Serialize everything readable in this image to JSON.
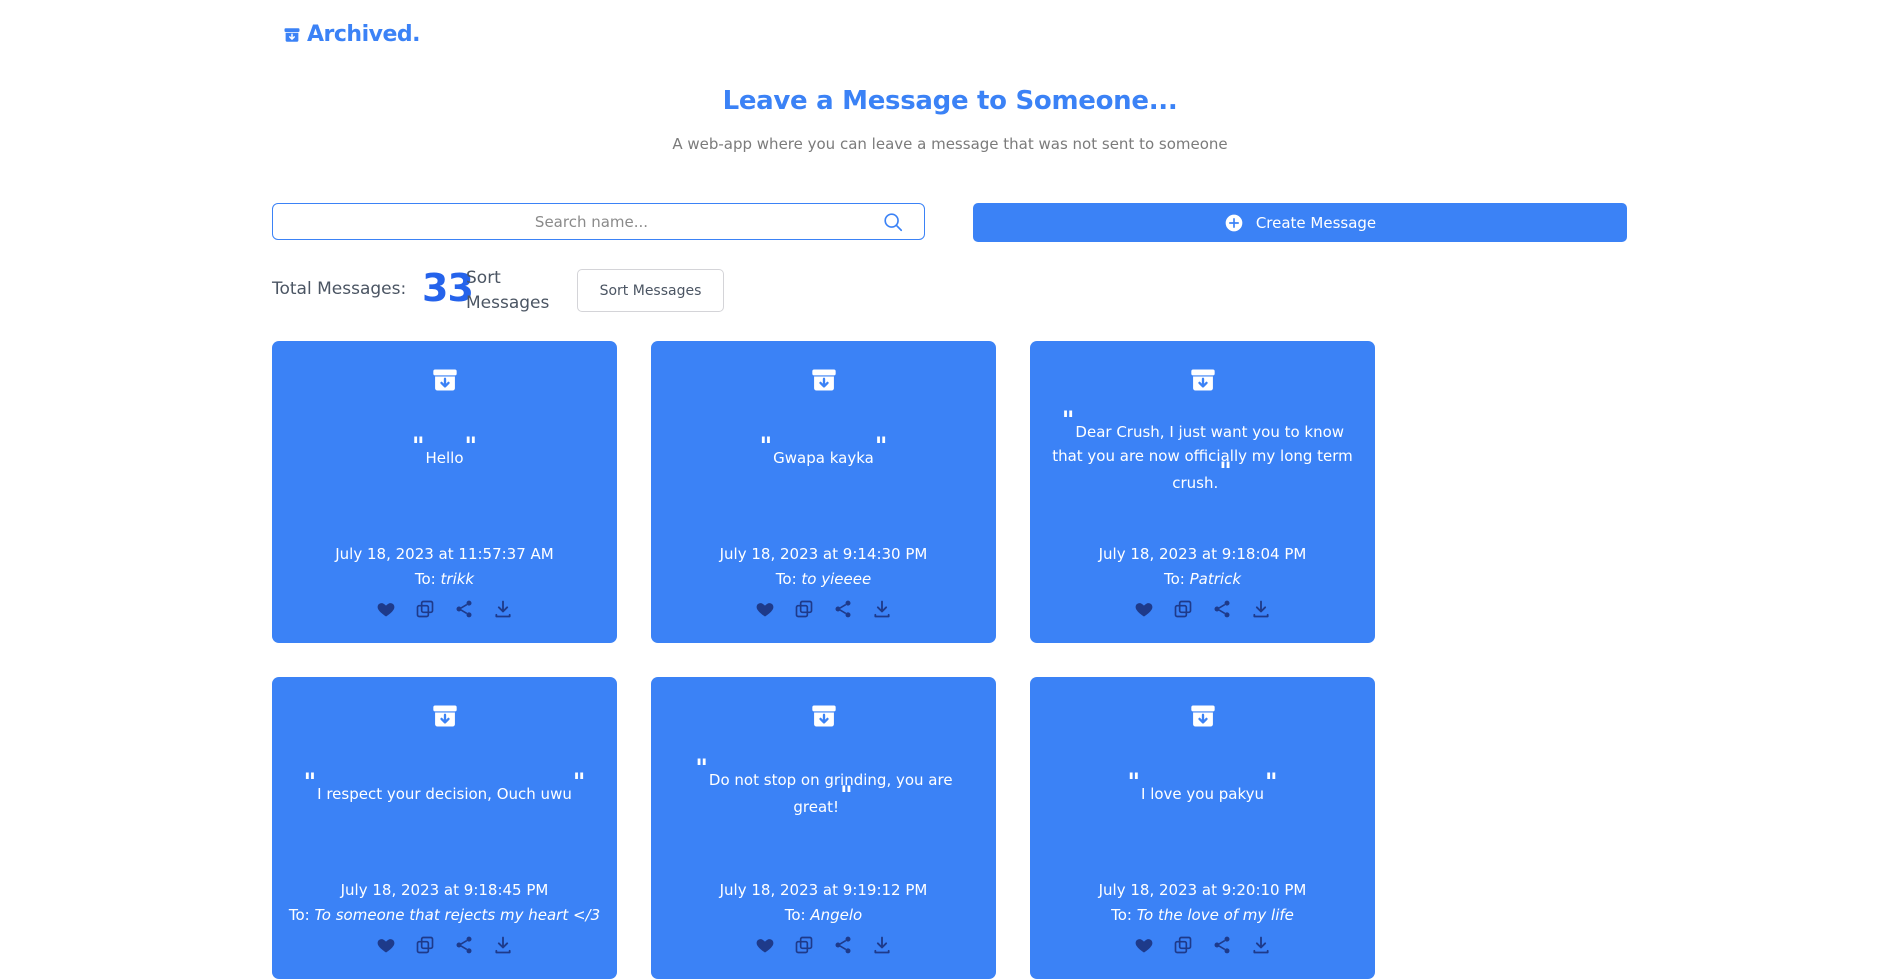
{
  "logo": {
    "text": "Archived."
  },
  "header": {
    "title": "Leave a Message to Someone...",
    "subtitle": "A web-app where you can leave a message that was not sent to someone"
  },
  "search": {
    "placeholder": "Search name..."
  },
  "create_button": {
    "label": "Create Message"
  },
  "stats": {
    "total_label": "Total Messages:",
    "total_count": "33",
    "sort_label": "Sort Messages",
    "sort_button": "Sort Messages"
  },
  "cards": [
    {
      "message": "Hello",
      "date": "July 18, 2023 at 11:57:37 AM",
      "to_prefix": "To:",
      "recipient": "trikk"
    },
    {
      "message": "Gwapa kayka",
      "date": "July 18, 2023 at 9:14:30 PM",
      "to_prefix": "To:",
      "recipient": "to yieeee"
    },
    {
      "message": "Dear Crush, I just want you to know that you are now officially my long term crush.",
      "date": "July 18, 2023 at 9:18:04 PM",
      "to_prefix": "To:",
      "recipient": "Patrick"
    },
    {
      "message": "I respect your decision, Ouch uwu",
      "date": "July 18, 2023 at 9:18:45 PM",
      "to_prefix": "To:",
      "recipient": "To someone that rejects my heart </3"
    },
    {
      "message": "Do not stop on grinding, you are great!",
      "date": "July 18, 2023 at 9:19:12 PM",
      "to_prefix": "To:",
      "recipient": "Angelo"
    },
    {
      "message": "I love you pakyu",
      "date": "July 18, 2023 at 9:20:10 PM",
      "to_prefix": "To:",
      "recipient": "To the love of my life"
    }
  ],
  "colors": {
    "primary": "#3b82f6",
    "count": "#2563eb",
    "icon_dark": "#1e3a8a"
  }
}
